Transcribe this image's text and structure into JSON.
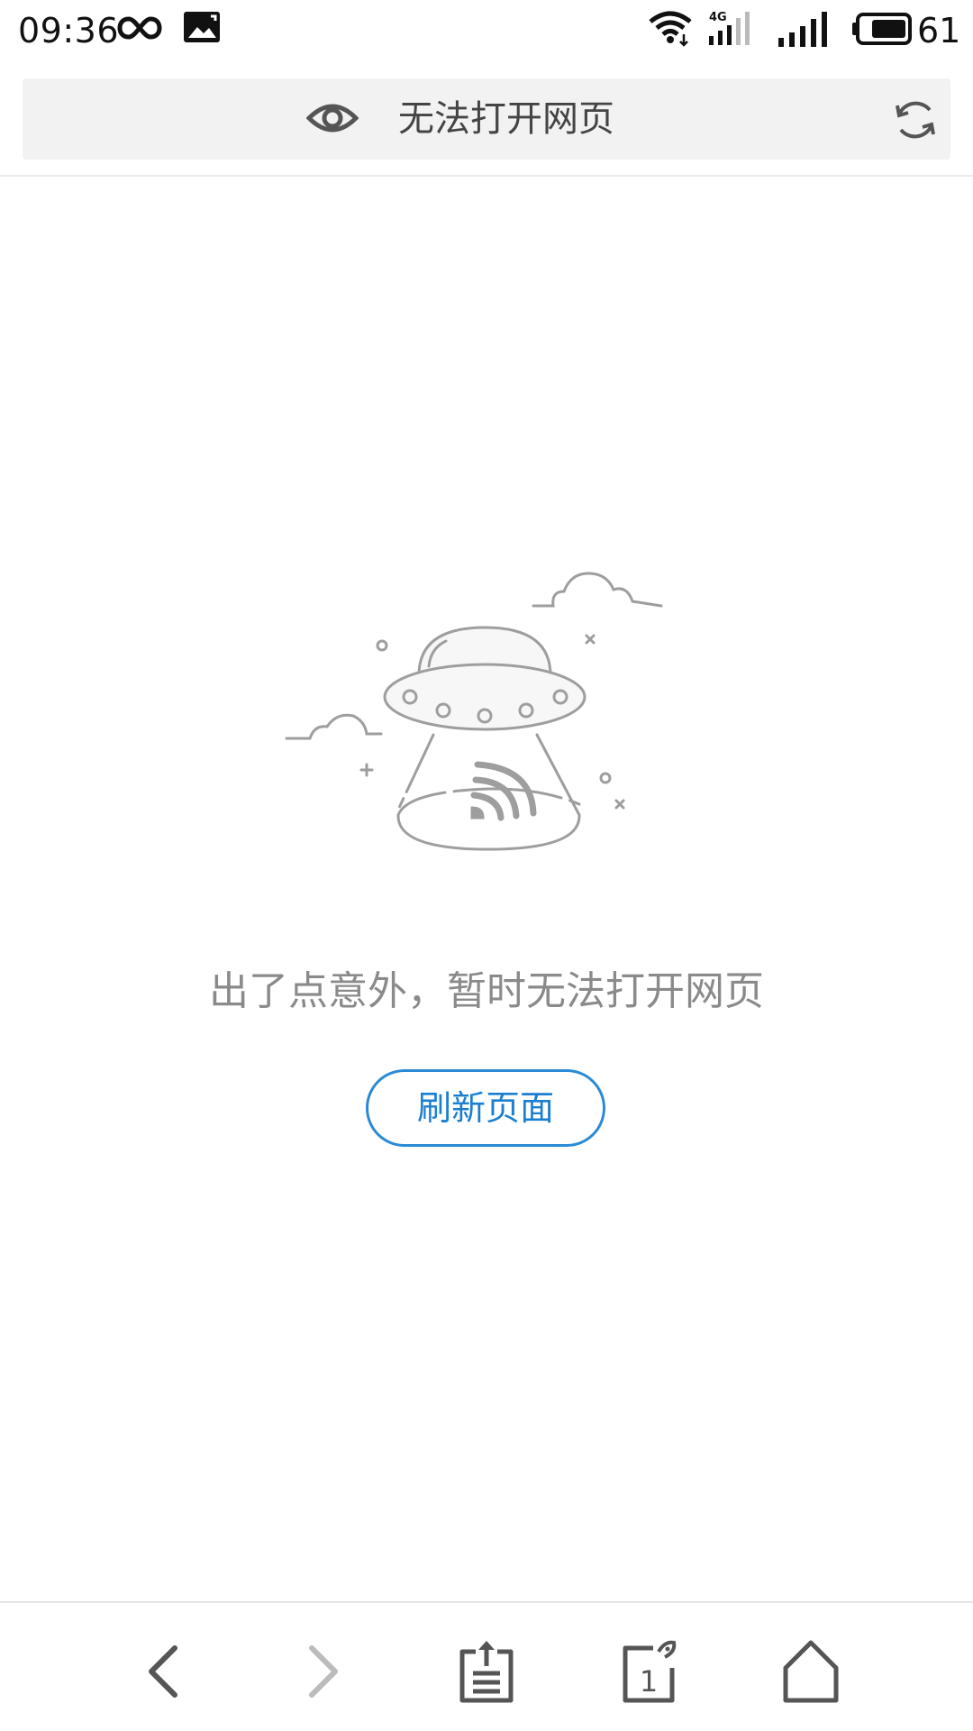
{
  "status_bar": {
    "time": "09:36",
    "battery_level": "61",
    "network_type": "4G",
    "icons": [
      "infinity-icon",
      "gallery-icon",
      "wifi-icon",
      "4g-signal-icon",
      "signal-icon",
      "battery-icon"
    ]
  },
  "address_bar": {
    "title": "无法打开网页",
    "icons": [
      "eye-icon",
      "refresh-icon"
    ]
  },
  "error": {
    "illustration": "ufo-illustration",
    "message": "出了点意外，暂时无法打开网页",
    "refresh_button": "刷新页面"
  },
  "toolbar": {
    "items": [
      "back-icon",
      "forward-icon",
      "share-icon",
      "tabs-icon",
      "home-icon"
    ],
    "tab_count": "1"
  },
  "colors": {
    "accent": "#2a8ad8",
    "message_gray": "#8a8a8a",
    "icon_gray": "#555555",
    "disabled_gray": "#bbbbbb",
    "address_bg": "#f2f2f2"
  }
}
